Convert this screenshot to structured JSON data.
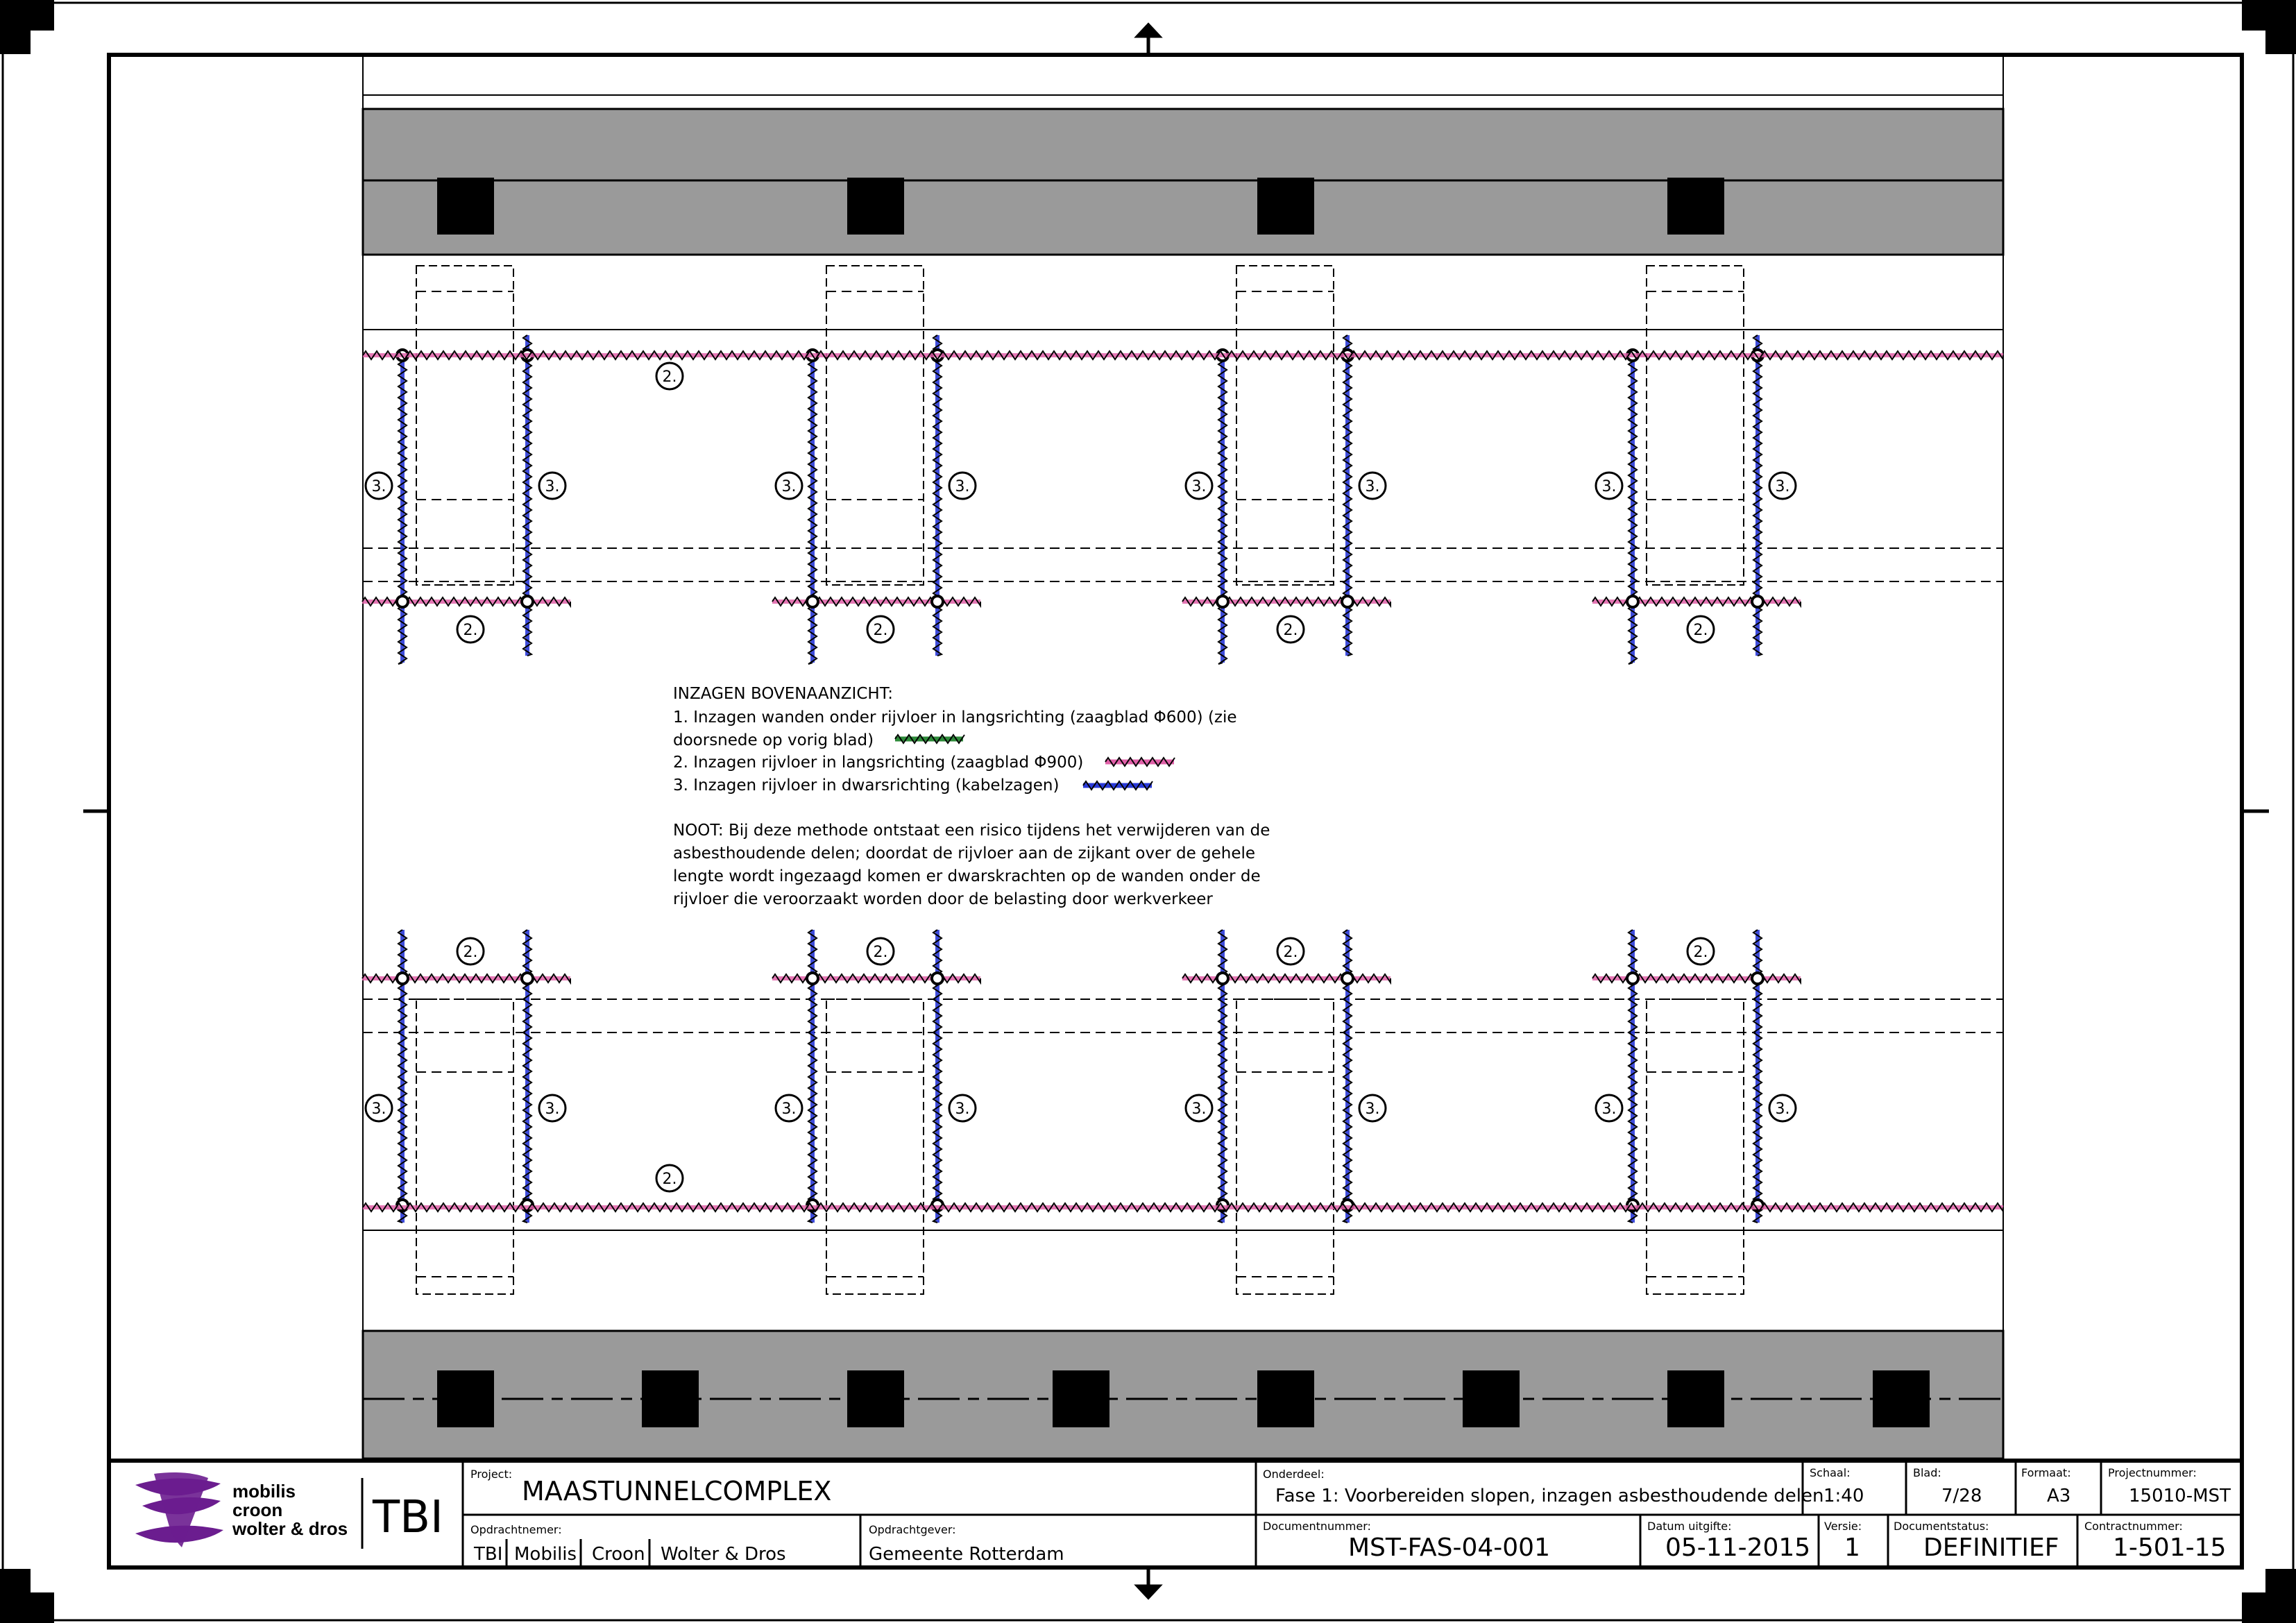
{
  "colors": {
    "line": "#000000",
    "wall_fill": "#9a9a9a",
    "cut_longitudinal": "#e060a8",
    "cut_transverse": "#2a3ad8",
    "cut_walls": "#2e8b3a",
    "logo": "#6b1d8f"
  },
  "markers": {
    "cut_longitudinal": "2.",
    "cut_transverse": "3."
  },
  "notes": {
    "heading": "INZAGEN BOVENAANZICHT:",
    "item1_line1": "1. Inzagen wanden onder rijvloer in langsrichting (zaagblad Φ600) (zie",
    "item1_line2": "doorsnede op vorig blad)",
    "item2": "2. Inzagen rijvloer in langsrichting (zaagblad Φ900)",
    "item3": "3. Inzagen rijvloer in dwarsrichting (kabelzagen)",
    "noot_line1": "NOOT: Bij deze methode ontstaat een risico tijdens het verwijderen van de",
    "noot_line2": "asbesthoudende delen; doordat de rijvloer aan de zijkant over de gehele",
    "noot_line3": "lengte wordt ingezaagd komen er dwarskrachten op de wanden onder de",
    "noot_line4": "rijvloer die veroorzaakt worden door de belasting door werkverkeer"
  },
  "title_block": {
    "logo_line1": "mobilis",
    "logo_line2": "croon",
    "logo_line3": "wolter & dros",
    "logo_tbi": "TBI",
    "project_label": "Project:",
    "project_value": "MAASTUNNELCOMPLEX",
    "onderdeel_label": "Onderdeel:",
    "onderdeel_value": "Fase 1: Voorbereiden slopen, inzagen asbesthoudende delen",
    "schaal_label": "Schaal:",
    "schaal_value": "1:40",
    "blad_label": "Blad:",
    "blad_value": "7/28",
    "formaat_label": "Formaat:",
    "formaat_value": "A3",
    "projectnummer_label": "Projectnummer:",
    "projectnummer_value": "15010-MST",
    "opdrachtnemer_label": "Opdrachtnemer:",
    "opdrachtnemer_values": [
      "TBI",
      "Mobilis",
      "Croon",
      "Wolter & Dros"
    ],
    "opdrachtgever_label": "Opdrachtgever:",
    "opdrachtgever_value": "Gemeente Rotterdam",
    "documentnummer_label": "Documentnummer:",
    "documentnummer_value": "MST-FAS-04-001",
    "datum_label": "Datum uitgifte:",
    "datum_value": "05-11-2015",
    "versie_label": "Versie:",
    "versie_value": "1",
    "status_label": "Documentstatus:",
    "status_value": "DEFINITIEF",
    "contract_label": "Contractnummer:",
    "contract_value": "1-501-15"
  }
}
